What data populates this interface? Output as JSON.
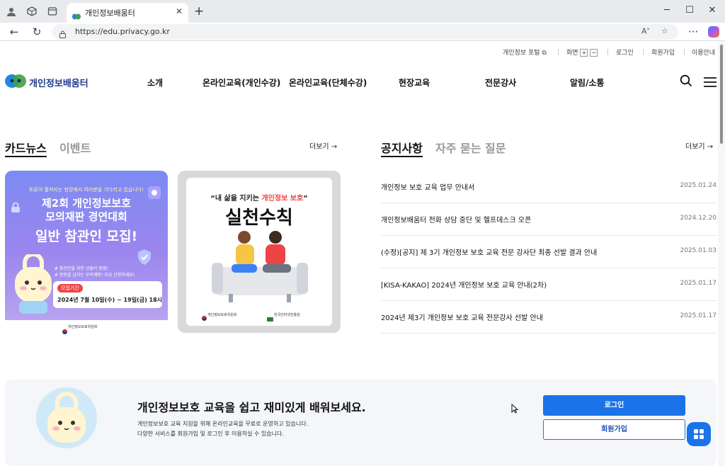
{
  "browser": {
    "tab_title": "개인정보배움터",
    "url": "https://edu.privacy.go.kr"
  },
  "utility_nav": {
    "portal": "개인정보 포털",
    "zoom_label": "화면",
    "zoom_in": "+",
    "zoom_out": "−",
    "login": "로그인",
    "join": "회원가입",
    "guide": "이용안내"
  },
  "header": {
    "logo_text": "개인정보배움터",
    "menu": [
      "소개",
      "온라인교육(개인수강)",
      "온라인교육(단체수강)",
      "현장교육",
      "전문강사",
      "알림/소통"
    ]
  },
  "card_section": {
    "tab_active": "카드뉴스",
    "tab_other": "이벤트",
    "more": "더보기 →",
    "card1": {
      "small": "토론이 펼쳐지는 현장에서 여러분을 기다리고 있습니다!",
      "title_line1": "제2회 개인정보보호",
      "title_line2": "모의재판 경연대회",
      "title_line3": "일반 참관인 모집!",
      "note1": "# 참관인을 위한 선물이 팡팡!",
      "note2": "# 현장을 넘치는 모의재판! 지금 신청하세요!",
      "period_label": "모집기간",
      "period": "2024년 7월 10일(수) ~ 19일(금) 18시",
      "org": "개인정보보호위원회"
    },
    "card2": {
      "quote_a": "“내 삶을 지키는 ",
      "quote_b": "개인정보 보호",
      "quote_c": "”",
      "title": "실천수칙",
      "org1": "개인정보보호위원회",
      "org2": "한국인터넷진흥원"
    }
  },
  "notice_section": {
    "tab_active": "공지사항",
    "tab_other": "자주 묻는 질문",
    "more": "더보기 →",
    "items": [
      {
        "title": "개인정보 보호 교육 업무 안내서",
        "date": "2025.01.24"
      },
      {
        "title": "개인정보배움터 전화 상담 중단 및 헬프데스크 오픈",
        "date": "2024.12.20"
      },
      {
        "title": "(수정)[공지] 제 3기 개인정보 보호 교육 전문 강사단 최종 선발 결과 안내",
        "date": "2025.01.03"
      },
      {
        "title": "[KISA-KAKAO] 2024년 개인정보 보호 교육 안내(2차)",
        "date": "2025.01.17"
      },
      {
        "title": "2024년 제3기 개인정보 보호 교육 전문강사 선발 안내",
        "date": "2025.01.17"
      }
    ]
  },
  "banner": {
    "title": "개인정보보호 교육을 쉽고 재미있게 배워보세요.",
    "desc1": "개인정보보호 교육 지원을 위해 온라인교육을 무료로 운영하고 있습니다.",
    "desc2": "다양한 서비스를 회원가입 및 로그인 후 이용하실 수 있습니다.",
    "login_button": "로그인",
    "join_button": "회원가입"
  },
  "colors": {
    "primary": "#1a73e8",
    "logo_blue": "#1e3a8a",
    "card_purple": "#8f89f0"
  }
}
